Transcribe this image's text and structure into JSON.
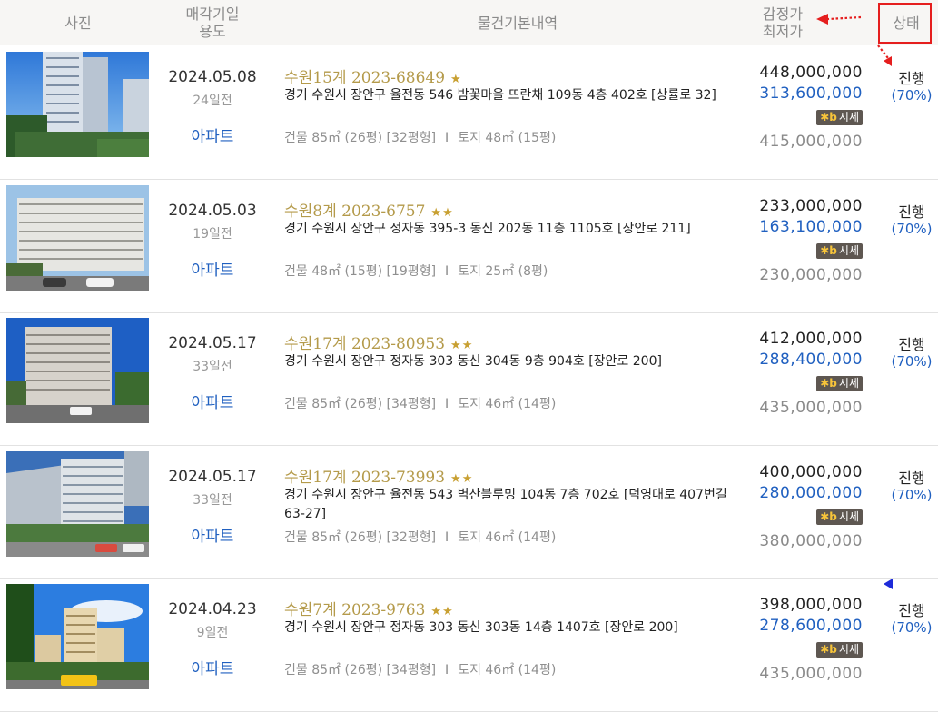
{
  "header": {
    "photo": "사진",
    "date_line1": "매각기일",
    "date_line2": "용도",
    "info": "물건기본내역",
    "price_line1": "감정가",
    "price_line2": "최저가",
    "status": "상태"
  },
  "colors": {
    "accent_blue": "#2060c0",
    "case_gold": "#b49a4a",
    "highlight_red": "#e51e1e"
  },
  "rows": [
    {
      "date": "2024.05.08",
      "ago": "24일전",
      "usage": "아파트",
      "case": "수원15계 2023-68649",
      "stars": "★",
      "address": "경기 수원시 장안구 율전동 546 밤꽃마을 뜨란채 109동 4층 402호 [상률로 32]",
      "building": "건물 85㎡ (26평) [32평형]",
      "land": "토지 48㎡ (15평)",
      "appraisal": "448,000,000",
      "min_price": "313,600,000",
      "market_label": "시세",
      "market_price": "415,000,000",
      "status": "진행",
      "pct": "(70%)"
    },
    {
      "date": "2024.05.03",
      "ago": "19일전",
      "usage": "아파트",
      "case": "수원8계 2023-6757",
      "stars": "★★",
      "address": "경기 수원시 장안구 정자동 395-3 동신 202동 11층 1105호 [장안로 211]",
      "building": "건물 48㎡ (15평) [19평형]",
      "land": "토지 25㎡ (8평)",
      "appraisal": "233,000,000",
      "min_price": "163,100,000",
      "market_label": "시세",
      "market_price": "230,000,000",
      "status": "진행",
      "pct": "(70%)"
    },
    {
      "date": "2024.05.17",
      "ago": "33일전",
      "usage": "아파트",
      "case": "수원17계 2023-80953",
      "stars": "★★",
      "address": "경기 수원시 장안구 정자동 303 동신 304동 9층 904호 [장안로 200]",
      "building": "건물 85㎡ (26평) [34평형]",
      "land": "토지 46㎡ (14평)",
      "appraisal": "412,000,000",
      "min_price": "288,400,000",
      "market_label": "시세",
      "market_price": "435,000,000",
      "status": "진행",
      "pct": "(70%)"
    },
    {
      "date": "2024.05.17",
      "ago": "33일전",
      "usage": "아파트",
      "case": "수원17계 2023-73993",
      "stars": "★★",
      "address": "경기 수원시 장안구 율전동 543 벽산블루밍 104동 7층 702호 [덕영대로 407번길 63-27]",
      "building": "건물 85㎡ (26평) [32평형]",
      "land": "토지 46㎡ (14평)",
      "appraisal": "400,000,000",
      "min_price": "280,000,000",
      "market_label": "시세",
      "market_price": "380,000,000",
      "status": "진행",
      "pct": "(70%)"
    },
    {
      "date": "2024.04.23",
      "ago": "9일전",
      "usage": "아파트",
      "case": "수원7계 2023-9763",
      "stars": "★★",
      "address": "경기 수원시 장안구 정자동 303 동신 303동 14층 1407호 [장안로 200]",
      "building": "건물 85㎡ (26평) [34평형]",
      "land": "토지 46㎡ (14평)",
      "appraisal": "398,000,000",
      "min_price": "278,600,000",
      "market_label": "시세",
      "market_price": "435,000,000",
      "status": "진행",
      "pct": "(70%)"
    }
  ]
}
